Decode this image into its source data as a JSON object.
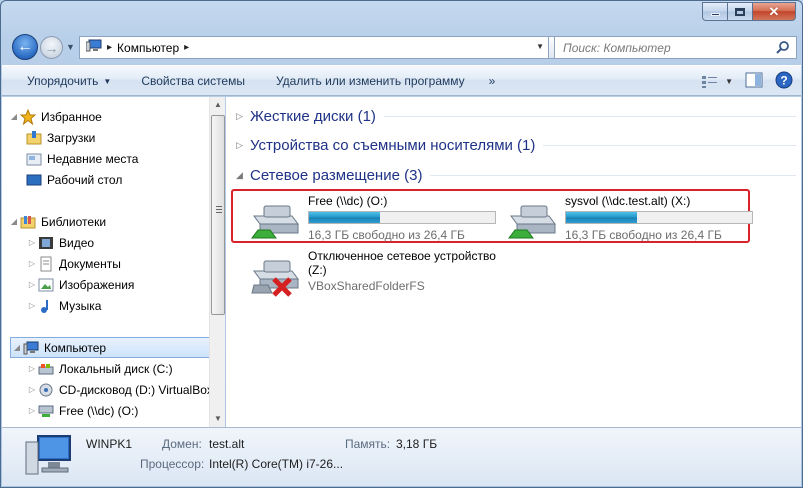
{
  "window": {
    "caption_buttons": {
      "minimize": "minimize",
      "maximize": "maximize",
      "close": "close"
    }
  },
  "address": {
    "crumb": "Компьютер",
    "search_placeholder": "Поиск: Компьютер"
  },
  "commands": {
    "organize": "Упорядочить",
    "system_props": "Свойства системы",
    "uninstall": "Удалить или изменить программу",
    "more": "»"
  },
  "nav": {
    "items": [
      {
        "label": "Избранное",
        "icon": "star-icon"
      },
      {
        "label": "Загрузки",
        "icon": "downloads-folder-icon"
      },
      {
        "label": "Недавние места",
        "icon": "recent-places-icon"
      },
      {
        "label": "Рабочий стол",
        "icon": "desktop-icon"
      },
      {
        "label": "Библиотеки",
        "icon": "libraries-icon"
      },
      {
        "label": "Видео",
        "icon": "video-library-icon"
      },
      {
        "label": "Документы",
        "icon": "documents-library-icon"
      },
      {
        "label": "Изображения",
        "icon": "pictures-library-icon"
      },
      {
        "label": "Музыка",
        "icon": "music-library-icon"
      },
      {
        "label": "Компьютер",
        "icon": "computer-icon"
      },
      {
        "label": "Локальный диск (C:)",
        "icon": "local-disk-icon"
      },
      {
        "label": "CD-дисковод (D:) VirtualBox",
        "icon": "cd-drive-icon"
      },
      {
        "label": "Free (\\\\dc) (O:)",
        "icon": "network-drive-icon"
      }
    ]
  },
  "groups": {
    "hard_disks": "Жесткие диски (1)",
    "removable": "Устройства со съемными носителями (1)",
    "network": "Сетевое размещение (3)"
  },
  "drives": [
    {
      "name": "Free (\\\\dc) (O:)",
      "free_text": "16,3 ГБ свободно из 26,4 ГБ",
      "used_fraction": 0.38
    },
    {
      "name": "sysvol (\\\\dc.test.alt) (X:)",
      "free_text": "16,3 ГБ свободно из 26,4 ГБ",
      "used_fraction": 0.38
    },
    {
      "name": "Отключенное сетевое устройство",
      "name2": "(Z:)",
      "sub": "VBoxSharedFolderFS"
    }
  ],
  "details": {
    "computer_name": "WINPK1",
    "domain_label": "Домен:",
    "domain_value": "test.alt",
    "memory_label": "Память:",
    "memory_value": "3,18 ГБ",
    "cpu_label": "Процессор:",
    "cpu_value": "Intel(R) Core(TM) i7-26..."
  },
  "colors": {
    "highlight_border": "#d8232a",
    "group_title": "#1e3287"
  }
}
